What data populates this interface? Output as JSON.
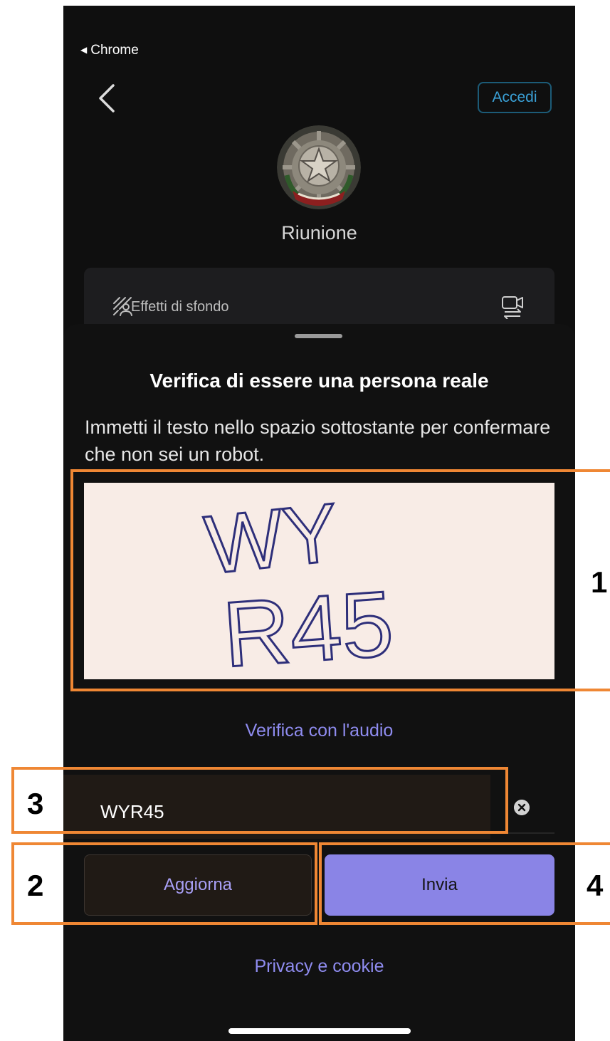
{
  "status_bar": {
    "back_app": "Chrome"
  },
  "header": {
    "signin_label": "Accedi"
  },
  "meeting": {
    "title": "Riunione",
    "effects_label": "Effetti di sfondo"
  },
  "captcha": {
    "title": "Verifica di essere una persona reale",
    "description": "Immetti il testo nello spazio sottostante per confermare che non sei un robot.",
    "image_text": "WYR45",
    "audio_link": "Verifica con l'audio",
    "input_value": "WYR45",
    "refresh_label": "Aggiorna",
    "submit_label": "Invia",
    "privacy_link": "Privacy e cookie"
  },
  "annotations": {
    "labels": [
      "1",
      "2",
      "3",
      "4"
    ],
    "color": "#ef8734"
  },
  "colors": {
    "accent": "#8a84e6",
    "link": "#8f8cf0",
    "signin": "#3aa0d6"
  }
}
